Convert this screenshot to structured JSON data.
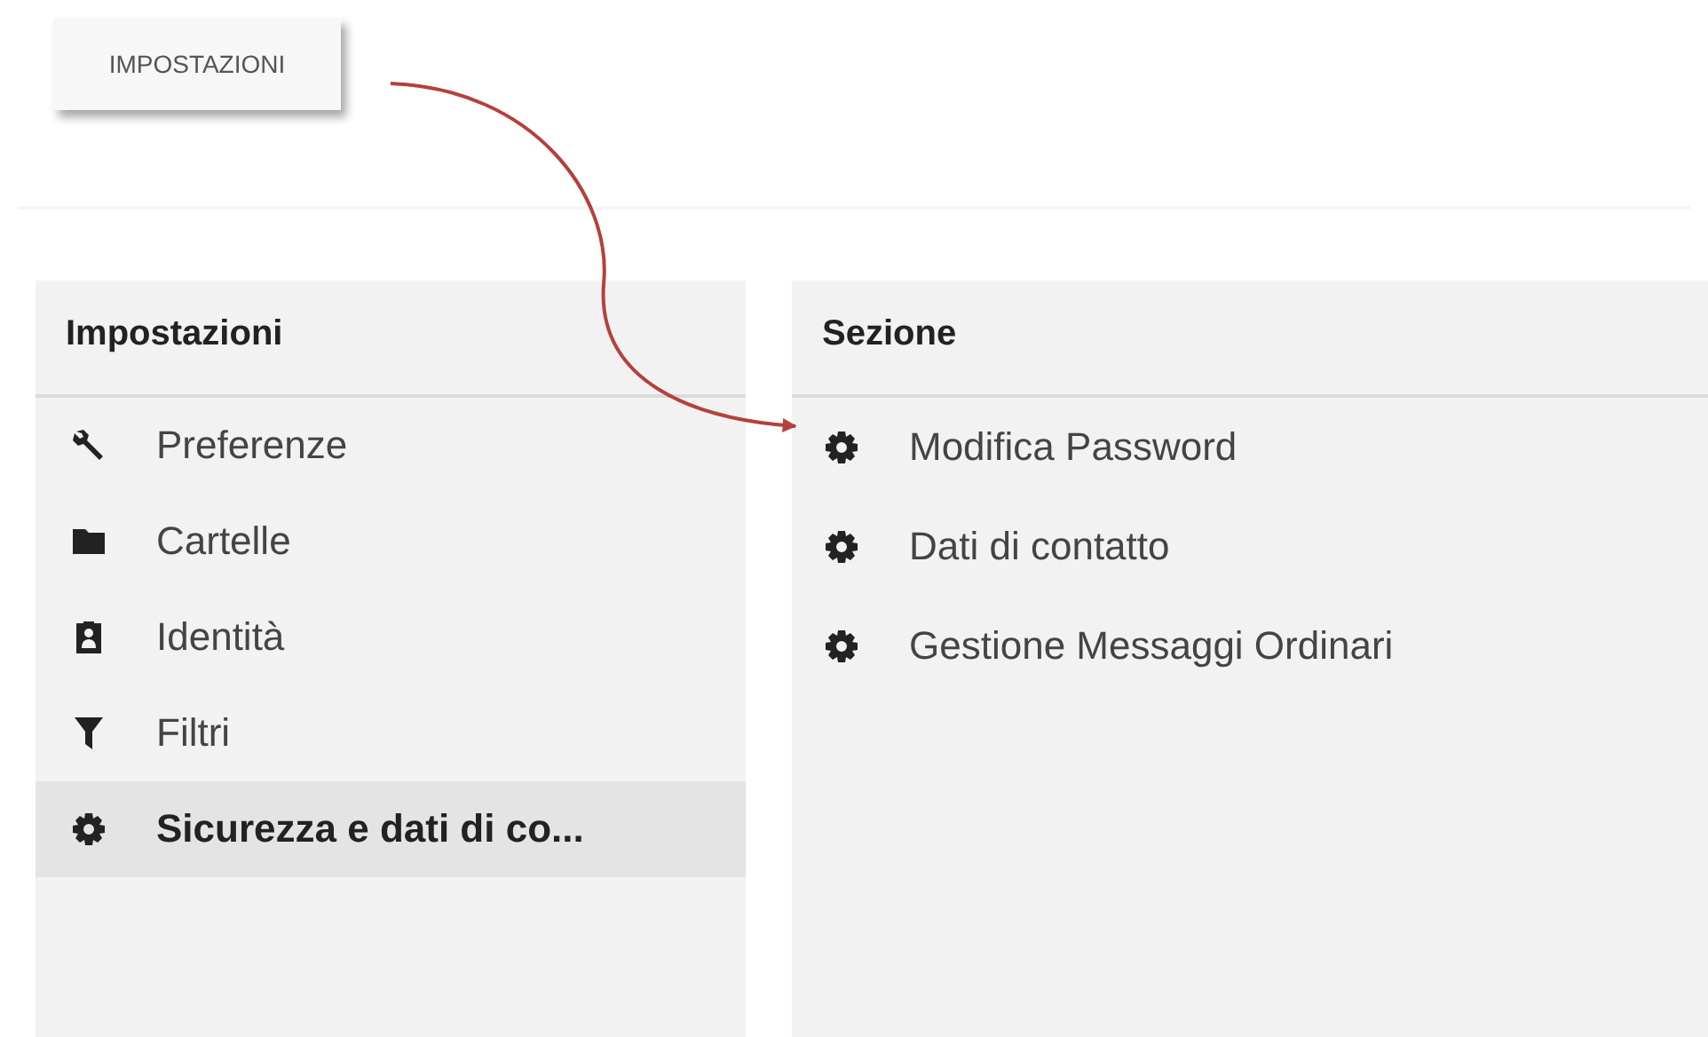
{
  "top_button": {
    "label": "IMPOSTAZIONI"
  },
  "settings_panel": {
    "title": "Impostazioni",
    "items": [
      {
        "label": "Preferenze",
        "selected": false
      },
      {
        "label": "Cartelle",
        "selected": false
      },
      {
        "label": "Identità",
        "selected": false
      },
      {
        "label": "Filtri",
        "selected": false
      },
      {
        "label": "Sicurezza e dati di co...",
        "selected": true
      }
    ]
  },
  "section_panel": {
    "title": "Sezione",
    "items": [
      {
        "label": "Modifica Password"
      },
      {
        "label": "Dati di contatto"
      },
      {
        "label": "Gestione Messaggi Ordinari"
      }
    ]
  }
}
